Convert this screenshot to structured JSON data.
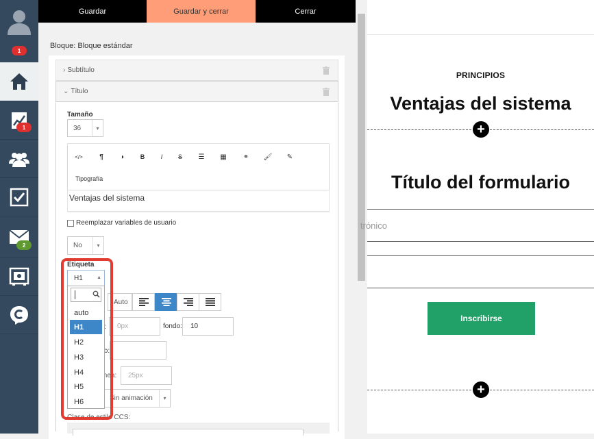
{
  "toolbar": {
    "save_label": "Guardar",
    "save_close_label": "Guardar y cerrar",
    "close_label": "Cerrar"
  },
  "sidebar": {
    "profile_badge": "1",
    "stats_badge": "1",
    "mail_badge": "2",
    "items": [
      "avatar-icon",
      "home-icon",
      "chart-icon",
      "users-icon",
      "checklist-icon",
      "mail-icon",
      "safe-icon",
      "chat-logo-icon"
    ]
  },
  "editor_panel": {
    "block_label": "Bloque: Bloque estándar",
    "subtitle_section": "Subtítulo",
    "title_section": "Título",
    "size_label": "Tamaño",
    "size_value": "36",
    "toolbar_icons": [
      "code-icon",
      "paragraph-icon",
      "contrast-icon",
      "bold-icon",
      "italic-icon",
      "strikethrough-icon",
      "list-icon",
      "table-icon",
      "link-icon",
      "brush-icon",
      "pencil-icon"
    ],
    "typography_label": "Tipografía",
    "text_value": "Ventajas del sistema",
    "replace_vars_label": "Reemplazar variables de usuario",
    "replace_vars_checked": false,
    "no_select_value": "No",
    "tag_label": "Etiqueta",
    "tag_value": "H1",
    "tag_options": [
      "auto",
      "H1",
      "H2",
      "H3",
      "H4",
      "H5",
      "H6"
    ],
    "tag_selected": "H1",
    "auto_label": "Auto",
    "margin_top_suffix": ":",
    "margin_top_placeholder": "0px",
    "bottom_label": "fondo:",
    "bottom_value": "10",
    "height_suffix": "to:",
    "line_height_label": "ínea:",
    "line_height_placeholder": "25px",
    "animation_value": "Sin animación",
    "css_label": "Clase de estilo CCS:"
  },
  "preview": {
    "kicker": "PRINCIPIOS",
    "heading": "Ventajas del sistema",
    "form_title": "Título del formulario",
    "email_placeholder": "trónico",
    "submit_label": "Inscribirse"
  },
  "colors": {
    "sidebar": "#34495e",
    "accent_orange": "#ff9d78",
    "select_blue": "#3d87c9",
    "submit_green": "#21a167",
    "badge_red": "#e02f2f",
    "badge_green": "#5e9a2f",
    "highlight_red": "#e03c31"
  }
}
